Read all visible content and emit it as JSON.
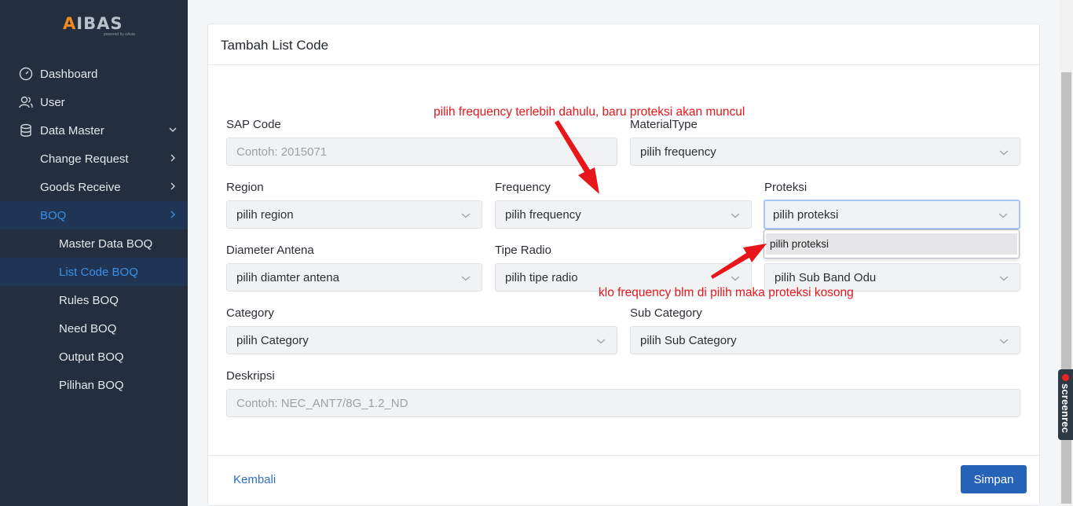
{
  "app": {
    "logo": "AIBAS",
    "logo_a": "A",
    "logo_rest": "IBAS",
    "logo_sub": "powered by eAsia"
  },
  "sidebar": {
    "items": [
      {
        "label": "Dashboard",
        "icon": "dashboard-icon"
      },
      {
        "label": "User",
        "icon": "user-icon"
      },
      {
        "label": "Data Master",
        "icon": "database-icon"
      },
      {
        "label": "Change Request"
      },
      {
        "label": "Goods Receive"
      },
      {
        "label": "BOQ"
      }
    ],
    "boq_sub": [
      {
        "label": "Master Data BOQ"
      },
      {
        "label": "List Code BOQ"
      },
      {
        "label": "Rules BOQ"
      },
      {
        "label": "Need BOQ"
      },
      {
        "label": "Output BOQ"
      },
      {
        "label": "Pilihan BOQ"
      }
    ]
  },
  "form": {
    "title": "Tambah List Code",
    "sap_code": {
      "label": "SAP Code",
      "placeholder": "Contoh: 2015071"
    },
    "material_type": {
      "label": "MaterialType",
      "value": "pilih frequency"
    },
    "region": {
      "label": "Region",
      "value": "pilih region"
    },
    "frequency": {
      "label": "Frequency",
      "value": "pilih frequency"
    },
    "proteksi": {
      "label": "Proteksi",
      "value": "pilih proteksi",
      "options": [
        "pilih proteksi"
      ]
    },
    "diameter": {
      "label": "Diameter Antena",
      "value": "pilih diamter antena"
    },
    "tipe_radio": {
      "label": "Tipe Radio",
      "value": "pilih tipe radio"
    },
    "sub_band": {
      "value": "pilih Sub Band Odu"
    },
    "category": {
      "label": "Category",
      "value": "pilih Category"
    },
    "sub_category": {
      "label": "Sub Category",
      "value": "pilih Sub Category"
    },
    "deskripsi": {
      "label": "Deskripsi",
      "placeholder": "Contoh: NEC_ANT7/8G_1.2_ND"
    },
    "back_label": "Kembali",
    "save_label": "Simpan"
  },
  "annotations": {
    "top": "pilih frequency terlebih dahulu, baru proteksi akan muncul",
    "bottom": "klo frequency blm di pilih maka proteksi kosong",
    "color": "#e8161b"
  },
  "overlay": {
    "screenrec": "screenrec"
  }
}
